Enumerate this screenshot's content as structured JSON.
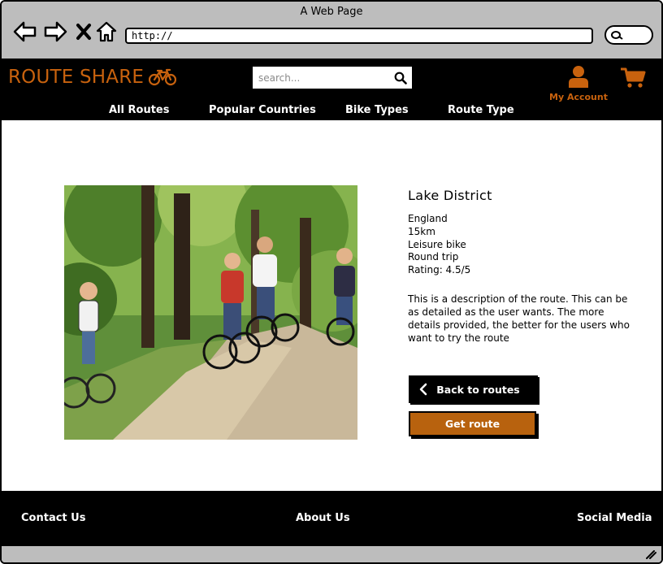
{
  "window": {
    "title": "A Web Page"
  },
  "browser": {
    "url": "http://"
  },
  "header": {
    "logo_text": "ROUTE SHARE",
    "search_placeholder": "search...",
    "account_label": "My Account",
    "menu": [
      "All Routes",
      "Popular Countries",
      "Bike Types",
      "Route Type"
    ]
  },
  "route": {
    "title": "Lake District",
    "country": "England",
    "distance": "15km",
    "bike_type": "Leisure bike",
    "route_type": "Round trip",
    "rating": "Rating: 4.5/5",
    "description": "This is a description of the route. This can be as detailed as the user wants. The more details provided, the better for the users who want to try the route"
  },
  "actions": {
    "back_label": "Back to routes",
    "get_label": "Get route"
  },
  "footer": {
    "contact": "Contact Us",
    "about": "About Us",
    "social": "Social Media"
  },
  "colors": {
    "brand_orange": "#c8620e",
    "header_bg": "#000000",
    "chrome_gray": "#bdbdbd"
  },
  "icons": [
    "back-arrow-icon",
    "forward-arrow-icon",
    "close-icon",
    "home-icon",
    "bicycle-icon",
    "search-icon",
    "user-icon",
    "cart-icon",
    "chevron-left-icon",
    "resize-grip-icon"
  ]
}
